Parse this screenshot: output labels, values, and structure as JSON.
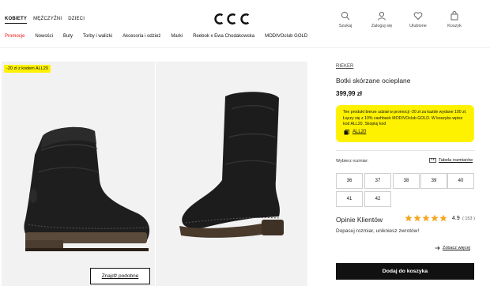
{
  "top_nav": [
    {
      "label": "KOBIETY",
      "active": true
    },
    {
      "label": "MĘŻCZYŹNI",
      "active": false
    },
    {
      "label": "DZIECI",
      "active": false
    }
  ],
  "logo": "CCC",
  "header_icons": [
    {
      "label": "Szukaj",
      "icon": "search-icon"
    },
    {
      "label": "Zaloguj się",
      "icon": "user-icon"
    },
    {
      "label": "Ulubione",
      "icon": "heart-icon"
    },
    {
      "label": "Koszyk",
      "icon": "bag-icon"
    }
  ],
  "category_nav": [
    "Promocje",
    "Nowości",
    "Buty",
    "Torby i walizki",
    "Akcesoria i odzież",
    "Marki",
    "Reebok x Ewa Chodakowska",
    "MODIVOclub GOLD"
  ],
  "gallery": {
    "promo_tag": "-20 zł z kodem ALL20",
    "find_similar": "Znajdź podobne"
  },
  "product": {
    "brand": "RIEKER",
    "name": "Botki skórzane ocieplane",
    "price": "399,99 zł",
    "promo_text": "Ten produkt bierze udział w promocji -20 zł za każde wydane 100 zł. Łączy się z 10% cashback MODIVOclub GOLD. W koszyku wpisz kod ALL20. Skopiuj kod",
    "promo_code": "ALL20",
    "size_label": "Wybierz rozmiar:",
    "size_table": "Tabela rozmiarów",
    "sizes": [
      "36",
      "37",
      "38",
      "39",
      "40",
      "41",
      "42"
    ],
    "reviews_title": "Opinie Klientów",
    "rating": "4.9",
    "rating_value": 4.9,
    "review_count": "( 153 )",
    "reviews_sub": "Dopasuj rozmiar, unikniesz zwrotów!",
    "see_more": "Zobacz więcej",
    "add_to_cart": "Dodaj do koszyka"
  },
  "colors": {
    "promo_yellow": "#fff200",
    "promo_red": "#e11111",
    "star_orange": "#f5a623",
    "cart_black": "#111111"
  }
}
